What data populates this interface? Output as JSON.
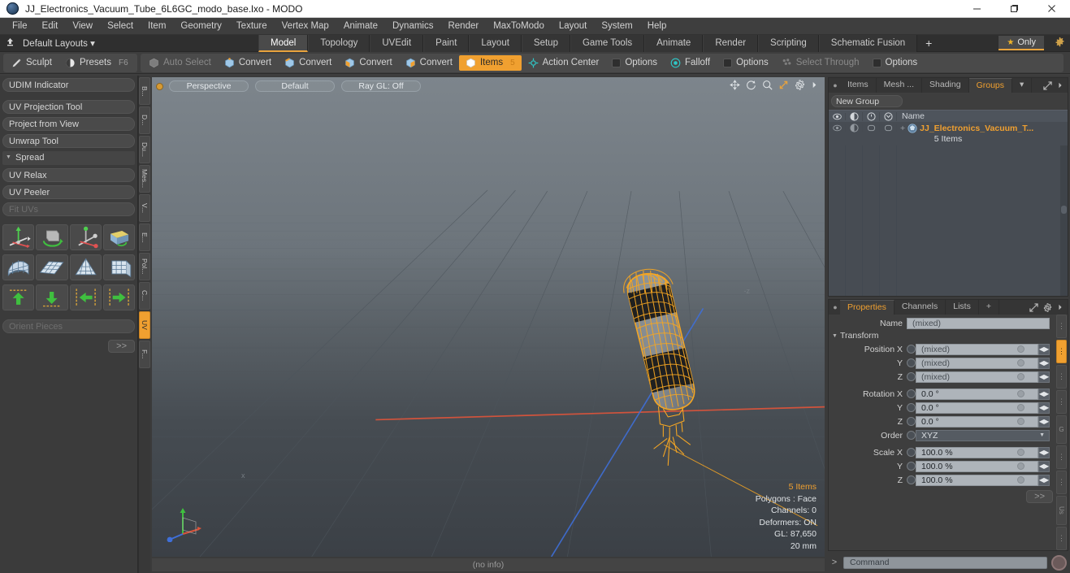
{
  "window": {
    "title": "JJ_Electronics_Vacuum_Tube_6L6GC_modo_base.lxo - MODO",
    "app_icon": "modo-logo-icon",
    "minimize": "–",
    "maximize": "❐",
    "close": "✕"
  },
  "menu": {
    "items": [
      "File",
      "Edit",
      "View",
      "Select",
      "Item",
      "Geometry",
      "Texture",
      "Vertex Map",
      "Animate",
      "Dynamics",
      "Render",
      "MaxToModo",
      "Layout",
      "System",
      "Help"
    ]
  },
  "layout_bar": {
    "layouts_label": "Default Layouts",
    "layouts_caret": "▾",
    "up_icon": "export-up-icon",
    "tabs": [
      {
        "label": "Model",
        "active": true
      },
      {
        "label": "Topology",
        "active": false
      },
      {
        "label": "UVEdit",
        "active": false
      },
      {
        "label": "Paint",
        "active": false
      },
      {
        "label": "Layout",
        "active": false
      },
      {
        "label": "Setup",
        "active": false
      },
      {
        "label": "Game Tools",
        "active": false
      },
      {
        "label": "Animate",
        "active": false
      },
      {
        "label": "Render",
        "active": false
      },
      {
        "label": "Scripting",
        "active": false
      },
      {
        "label": "Schematic Fusion",
        "active": false
      }
    ],
    "add_tab": "+",
    "only_label": "Only",
    "only_star": "★",
    "gear": "gear-icon"
  },
  "toolbar": {
    "group1": [
      {
        "label": "Sculpt",
        "icon": "brush-icon",
        "state": "normal",
        "badge": ""
      },
      {
        "label": "Presets",
        "icon": "sphere-icon",
        "state": "normal",
        "badge": "F6"
      }
    ],
    "group2": [
      {
        "label": "Auto Select",
        "icon": "cube-grey-icon",
        "state": "dim",
        "badge": ""
      },
      {
        "label": "Convert",
        "icon": "vertex-cube-icon",
        "state": "normal",
        "badge": ""
      },
      {
        "label": "Convert",
        "icon": "edge-cube-icon",
        "state": "normal",
        "badge": ""
      },
      {
        "label": "Convert",
        "icon": "poly-cube-icon",
        "state": "normal",
        "badge": ""
      },
      {
        "label": "Convert",
        "icon": "material-cube-icon",
        "state": "normal",
        "badge": ""
      },
      {
        "label": "Items",
        "icon": "item-cube-icon",
        "state": "on",
        "badge": "5"
      },
      {
        "label": "Action Center",
        "icon": "action-center-icon",
        "state": "normal",
        "badge": ""
      },
      {
        "label": "Options",
        "icon": "checkbox-icon",
        "state": "normal",
        "badge": ""
      },
      {
        "label": "Falloff",
        "icon": "falloff-icon",
        "state": "normal",
        "badge": ""
      },
      {
        "label": "Options",
        "icon": "checkbox-icon",
        "state": "normal",
        "badge": ""
      },
      {
        "label": "Select Through",
        "icon": "select-through-icon",
        "state": "dim",
        "badge": ""
      },
      {
        "label": "Options",
        "icon": "checkbox-icon",
        "state": "normal",
        "badge": ""
      }
    ]
  },
  "left_panel": {
    "buttons_top": [
      "UDIM Indicator"
    ],
    "buttons_group2": [
      "UV Projection Tool",
      "Project from View",
      "Unwrap Tool"
    ],
    "section_spread": "Spread",
    "buttons_group3": [
      {
        "label": "UV Relax",
        "dim": false
      },
      {
        "label": "UV Peeler",
        "dim": false
      },
      {
        "label": "Fit UVs",
        "dim": true
      }
    ],
    "icon_rows": [
      [
        "uv-move-axis-icon",
        "uv-rotate-cube-icon",
        "uv-scale-axis-icon",
        "uv-flip-cube-icon"
      ],
      [
        "uv-curve-grid-icon",
        "uv-flat-grid-icon",
        "uv-cone-grid-icon",
        "uv-box-grid-icon"
      ],
      [
        "uv-align-up-icon",
        "uv-align-down-icon",
        "uv-align-left-icon",
        "uv-align-right-icon"
      ]
    ],
    "orient_pieces": "Orient Pieces",
    "more_button": ">>",
    "vtabs": [
      {
        "label": "B...",
        "active": false
      },
      {
        "label": "D...",
        "active": false
      },
      {
        "label": "Du...",
        "active": false
      },
      {
        "label": "Mes...",
        "active": false
      },
      {
        "label": "V...",
        "active": false
      },
      {
        "label": "E...",
        "active": false
      },
      {
        "label": "Pol...",
        "active": false
      },
      {
        "label": "C...",
        "active": false
      },
      {
        "label": "UV",
        "active": true
      },
      {
        "label": "F...",
        "active": false
      }
    ]
  },
  "viewport": {
    "pills": [
      "Perspective",
      "Default",
      "Ray GL: Off"
    ],
    "dot": "viewport-menu-dot",
    "icons": [
      "pan-icon",
      "rotate-icon",
      "zoom-icon",
      "fit-icon",
      "gear-icon",
      "chevron-right-icon"
    ],
    "axis_label_z": "-z",
    "axis_label_x": "x",
    "gizmo": "axis-gizmo",
    "stats": {
      "items": "5 Items",
      "polygons": "Polygons : Face",
      "channels": "Channels: 0",
      "deformers": "Deformers: ON",
      "gl": "GL: 87,650",
      "scale": "20 mm"
    },
    "status": "(no info)"
  },
  "items_panel": {
    "tabs": [
      {
        "label": "Items",
        "active": false
      },
      {
        "label": "Mesh ...",
        "active": false
      },
      {
        "label": "Shading",
        "active": false
      },
      {
        "label": "Groups",
        "active": true
      }
    ],
    "caret": "▾",
    "expand_icon": "expand-icon",
    "chevron_icon": "chevron-right-icon",
    "new_group_button": "New Group",
    "column_icons": [
      "eye-icon",
      "shade-icon",
      "lock-icon",
      "render-icon"
    ],
    "name_column": "Name",
    "row": {
      "expander": "+",
      "icon": "group-icon",
      "name": "JJ_Electronics_Vacuum_T...",
      "sub": "5 Items"
    }
  },
  "properties_panel": {
    "tabs": [
      {
        "label": "Properties",
        "active": true
      },
      {
        "label": "Channels",
        "active": false
      },
      {
        "label": "Lists",
        "active": false
      }
    ],
    "add": "+",
    "expand_icon": "expand-icon",
    "gear_icon": "gear-icon",
    "chevron_icon": "chevron-right-icon",
    "name_label": "Name",
    "name_value": "(mixed)",
    "transform_section": "Transform",
    "fields": [
      {
        "label": "Position X",
        "value": "(mixed)",
        "type": "text"
      },
      {
        "label": "Y",
        "value": "(mixed)",
        "type": "text"
      },
      {
        "label": "Z",
        "value": "(mixed)",
        "type": "text"
      },
      {
        "label": "Rotation X",
        "value": "0.0 °",
        "type": "text"
      },
      {
        "label": "Y",
        "value": "0.0 °",
        "type": "text"
      },
      {
        "label": "Z",
        "value": "0.0 °",
        "type": "text"
      },
      {
        "label": "Order",
        "value": "XYZ",
        "type": "select"
      },
      {
        "label": "Scale X",
        "value": "100.0 %",
        "type": "text"
      },
      {
        "label": "Y",
        "value": "100.0 %",
        "type": "text"
      },
      {
        "label": "Z",
        "value": "100.0 %",
        "type": "text"
      }
    ],
    "more_button": ">>",
    "side_chips": [
      {
        "label": "",
        "active": false
      },
      {
        "label": "",
        "active": true
      },
      {
        "label": "",
        "active": false
      },
      {
        "label": "",
        "active": false
      },
      {
        "label": "G",
        "active": false
      },
      {
        "label": "",
        "active": false
      },
      {
        "label": "",
        "active": false
      },
      {
        "label": "Us",
        "active": false
      },
      {
        "label": "",
        "active": false
      }
    ]
  },
  "command_bar": {
    "prompt": ">",
    "placeholder": "Command",
    "record_button": "record-icon"
  },
  "colors": {
    "accent": "#f0a030",
    "panel": "#3e3e3e",
    "field": "#aeb4ba",
    "wire": "#f5a623"
  }
}
